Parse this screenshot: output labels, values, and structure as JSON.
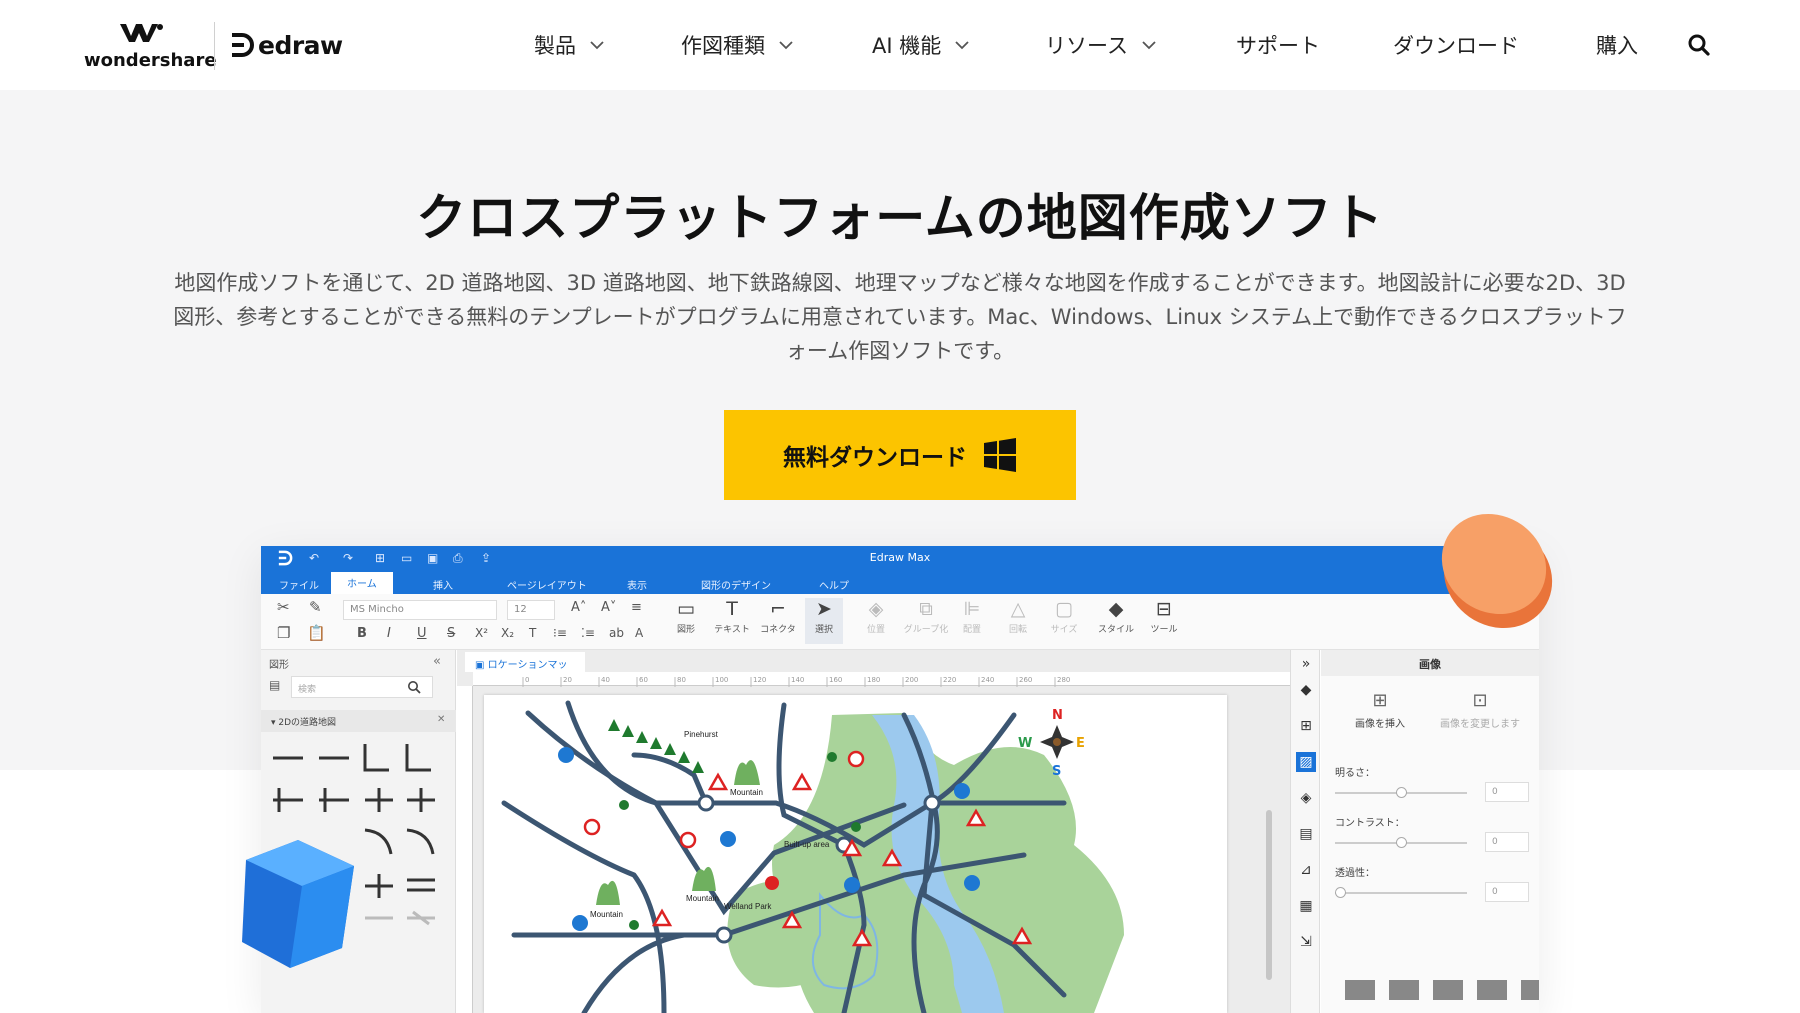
{
  "nav": {
    "brand_wondershare": "wondershare",
    "brand_edraw": "edraw",
    "items": [
      {
        "label": "製品",
        "has_dropdown": true
      },
      {
        "label": "作図種類",
        "has_dropdown": true
      },
      {
        "label": "AI 機能",
        "has_dropdown": true
      },
      {
        "label": "リソース",
        "has_dropdown": true
      },
      {
        "label": "サポート",
        "has_dropdown": false
      },
      {
        "label": "ダウンロード",
        "has_dropdown": false
      },
      {
        "label": "購入",
        "has_dropdown": false
      }
    ],
    "search_icon": "search-icon"
  },
  "hero": {
    "title": "クロスプラットフォームの地図作成ソフト",
    "description_line1": "地図作成ソフトを通じて、2D 道路地図、3D 道路地図、地下鉄路線図、地理マップなど様々な地図を作成することができます。地図設計に必要な2D、3D",
    "description_line2": "図形、参考とすることができる無料のテンプレートがプログラムに用意されています。Mac、Windows、Linux システム上で動作できるクロスプラットフ",
    "description_line3": "ォーム作図ソフトです。",
    "cta_label": "無料ダウンロード",
    "cta_icon": "windows-icon",
    "cta_color": "#fcc400"
  },
  "app": {
    "window_title": "Edraw Max",
    "tabs": [
      "ファイル",
      "ホーム",
      "挿入",
      "ページレイアウト",
      "表示",
      "図形のデザイン",
      "ヘルプ"
    ],
    "active_tab": "ホーム",
    "font_name": "MS Mincho",
    "font_size": "12",
    "tools": [
      {
        "label": "図形",
        "icon": "rectangle-icon"
      },
      {
        "label": "テキスト",
        "icon": "text-icon"
      },
      {
        "label": "コネクタ",
        "icon": "connector-icon"
      },
      {
        "label": "選択",
        "icon": "cursor-icon"
      },
      {
        "label": "位置",
        "icon": "layers-icon"
      },
      {
        "label": "グループ化",
        "icon": "group-icon"
      },
      {
        "label": "配置",
        "icon": "align-icon"
      },
      {
        "label": "回転",
        "icon": "rotate-icon"
      },
      {
        "label": "サイズ",
        "icon": "size-icon"
      },
      {
        "label": "スタイル",
        "icon": "paint-bucket-icon"
      },
      {
        "label": "ツール",
        "icon": "tools-icon"
      }
    ],
    "left_panel": {
      "title": "図形",
      "search_placeholder": "検索",
      "category": "2Dの道路地図"
    },
    "doc_tab": "ロケーションマップ3",
    "ruler_ticks": [
      "0",
      "20",
      "40",
      "60",
      "80",
      "100",
      "120",
      "140",
      "160",
      "180",
      "200",
      "220",
      "240",
      "260",
      "280"
    ],
    "map_labels": {
      "pinehurst": "Pinehurst",
      "mountain1": "Mountain",
      "mountain2": "Mountain",
      "mountain3": "Mountain",
      "builtup": "Built-up area",
      "welland": "Welland Park",
      "compass_n": "N",
      "compass_s": "S",
      "compass_e": "E",
      "compass_w": "W"
    },
    "props": {
      "title": "画像",
      "insert_image": "画像を挿入",
      "change_image": "画像を変更します",
      "brightness": "明るさ：",
      "contrast": "コントラスト：",
      "transparency": "透過性：",
      "brightness_value": "0",
      "contrast_value": "0",
      "transparency_value": "0",
      "brightness_level": 0.5,
      "contrast_level": 0.5,
      "transparency_level": 0.0
    },
    "accent_color": "#1a73d8"
  },
  "decorations": {
    "orange_disc_color": "#f5924a",
    "blue_cube_color": "#2b8df0"
  }
}
